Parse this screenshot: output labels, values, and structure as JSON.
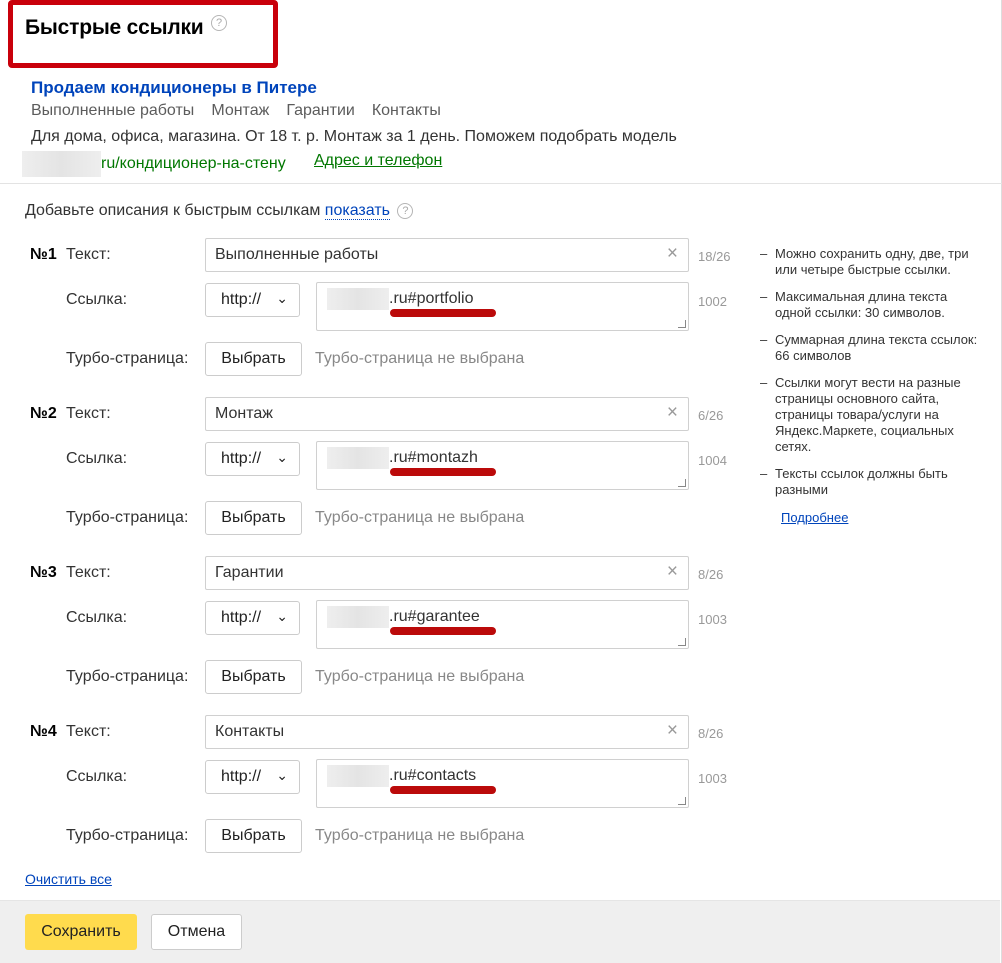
{
  "header": {
    "title": "Быстрые ссылки"
  },
  "preview": {
    "ad_title": "Продаем кондиционеры в Питере",
    "sitelinks": [
      "Выполненные работы",
      "Монтаж",
      "Гарантии",
      "Контакты"
    ],
    "text": "Для дома, офиса, магазина. От 18 т. р. Монтаж за 1 день. Поможем подобрать модель",
    "url": "ru/кондиционер-на-стену",
    "contact_link": "Адрес и телефон"
  },
  "hint": {
    "text": "Добавьте описания к быстрым ссылкам",
    "link": "показать"
  },
  "labels": {
    "text": "Текст:",
    "link": "Ссылка:",
    "turbo": "Турбо-страница:"
  },
  "items": [
    {
      "num": "№1",
      "text": "Выполненные работы",
      "text_count": "18/26",
      "protocol": "http://",
      "link": ".ru#portfolio",
      "link_count": "1002",
      "turbo_button": "Выбрать",
      "turbo_status": "Турбо-страница не выбрана"
    },
    {
      "num": "№2",
      "text": "Монтаж",
      "text_count": "6/26",
      "protocol": "http://",
      "link": ".ru#montazh",
      "link_count": "1004",
      "turbo_button": "Выбрать",
      "turbo_status": "Турбо-страница не выбрана"
    },
    {
      "num": "№3",
      "text": "Гарантии",
      "text_count": "8/26",
      "protocol": "http://",
      "link": ".ru#garantee",
      "link_count": "1003",
      "turbo_button": "Выбрать",
      "turbo_status": "Турбо-страница не выбрана"
    },
    {
      "num": "№4",
      "text": "Контакты",
      "text_count": "8/26",
      "protocol": "http://",
      "link": ".ru#contacts",
      "link_count": "1003",
      "turbo_button": "Выбрать",
      "turbo_status": "Турбо-страница не выбрана"
    }
  ],
  "tips": [
    "Можно сохранить одну, две, три или четыре быстрые ссылки.",
    "Максимальная длина текста одной ссылки: 30 символов.",
    "Суммарная длина текста ссылок: 66 символов",
    "Ссылки могут вести на разные страницы основного сайта, страницы товара/услуги на Яндекс.Маркете, социальных сетях.",
    "Тексты ссылок должны быть разными"
  ],
  "more_link": "Подробнее",
  "clear_all": "Очистить все",
  "footer": {
    "save": "Сохранить",
    "cancel": "Отмена"
  },
  "icons": {
    "help": "?",
    "clear": "×",
    "chevron": "⌄"
  }
}
